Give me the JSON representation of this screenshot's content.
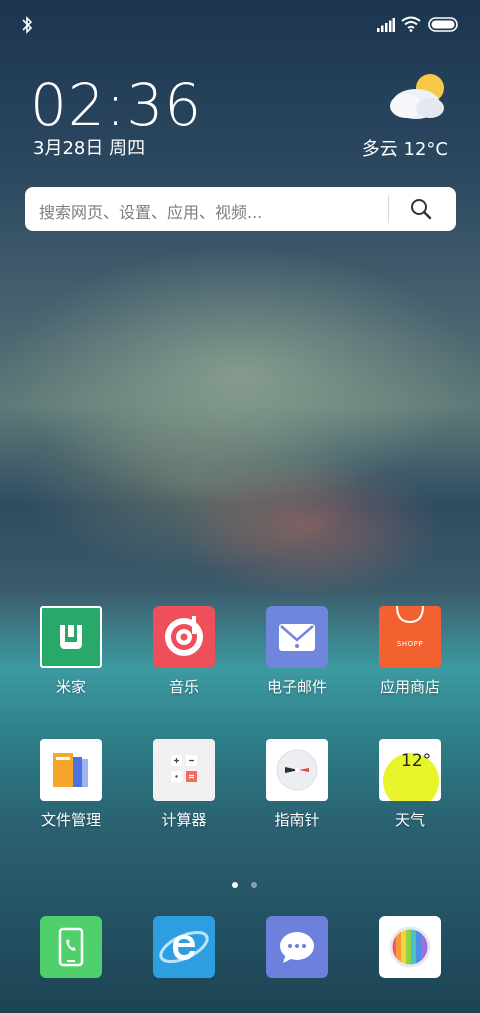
{
  "status": {
    "icons": [
      "bluetooth-icon",
      "signal-icon",
      "wifi-icon",
      "battery-icon"
    ]
  },
  "clock": {
    "time": "02:36",
    "date": "3月28日 周四"
  },
  "weather": {
    "icon": "partly-cloudy-icon",
    "text": "多云  12°C"
  },
  "search": {
    "placeholder": "搜索网页、设置、应用、视频..."
  },
  "apps_row1": [
    {
      "label": "米家",
      "icon": "mijia-icon",
      "color": "#28a869"
    },
    {
      "label": "音乐",
      "icon": "music-icon",
      "color": "#ef4f5a"
    },
    {
      "label": "电子邮件",
      "icon": "email-icon",
      "color": "#6f86dc"
    },
    {
      "label": "应用商店",
      "icon": "app-store-icon",
      "color": "#f2612f",
      "badge": "SHOPP"
    }
  ],
  "apps_row2": [
    {
      "label": "文件管理",
      "icon": "file-manager-icon"
    },
    {
      "label": "计算器",
      "icon": "calculator-icon"
    },
    {
      "label": "指南针",
      "icon": "compass-icon"
    },
    {
      "label": "天气",
      "icon": "weather-app-icon",
      "temp": "12°"
    }
  ],
  "page_indicator": {
    "current": 1,
    "total": 2
  },
  "dock": [
    {
      "icon": "phone-icon",
      "color": "#4fd06b"
    },
    {
      "icon": "browser-icon",
      "color": "#2d9fe0"
    },
    {
      "icon": "messages-icon",
      "color": "#6d80dc"
    },
    {
      "icon": "gallery-icon",
      "color": "#ffffff"
    }
  ]
}
